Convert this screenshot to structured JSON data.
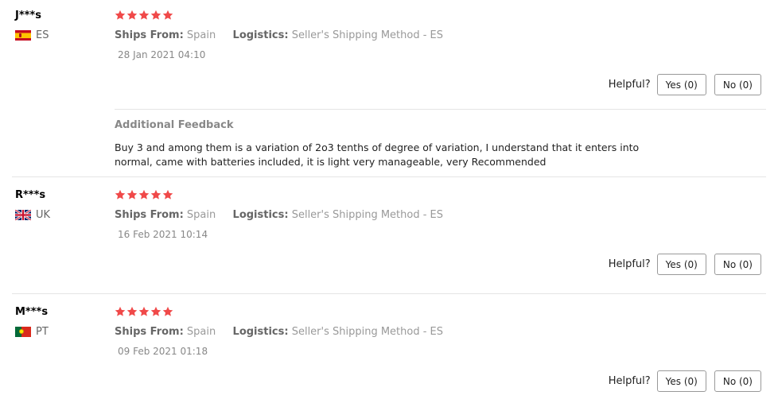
{
  "reviews": [
    {
      "user": "J***s",
      "country": "ES",
      "flag_icon": "spain-flag-icon",
      "rating": 5,
      "ships_from_label": "Ships From:",
      "ships_from": "Spain",
      "logistics_label": "Logistics:",
      "logistics": "Seller's Shipping Method - ES",
      "date": "28 Jan 2021 04:10",
      "helpful_label": "Helpful?",
      "yes_label": "Yes (0)",
      "no_label": "No (0)",
      "additional_feedback_title": "Additional Feedback",
      "additional_feedback_text": "Buy 3 and among them is a variation of 2o3 tenths of degree of variation, I understand that it enters into normal, came with batteries included, it is light very manageable, very Recommended"
    },
    {
      "user": "R***s",
      "country": "UK",
      "flag_icon": "uk-flag-icon",
      "rating": 5,
      "ships_from_label": "Ships From:",
      "ships_from": "Spain",
      "logistics_label": "Logistics:",
      "logistics": "Seller's Shipping Method - ES",
      "date": "16 Feb 2021 10:14",
      "helpful_label": "Helpful?",
      "yes_label": "Yes (0)",
      "no_label": "No (0)"
    },
    {
      "user": "M***s",
      "country": "PT",
      "flag_icon": "portugal-flag-icon",
      "rating": 5,
      "ships_from_label": "Ships From:",
      "ships_from": "Spain",
      "logistics_label": "Logistics:",
      "logistics": "Seller's Shipping Method - ES",
      "date": "09 Feb 2021 01:18",
      "helpful_label": "Helpful?",
      "yes_label": "Yes (0)",
      "no_label": "No (0)"
    }
  ],
  "colors": {
    "star": "#f04949",
    "divider": "#e5e5e5",
    "muted_text": "#999999"
  }
}
